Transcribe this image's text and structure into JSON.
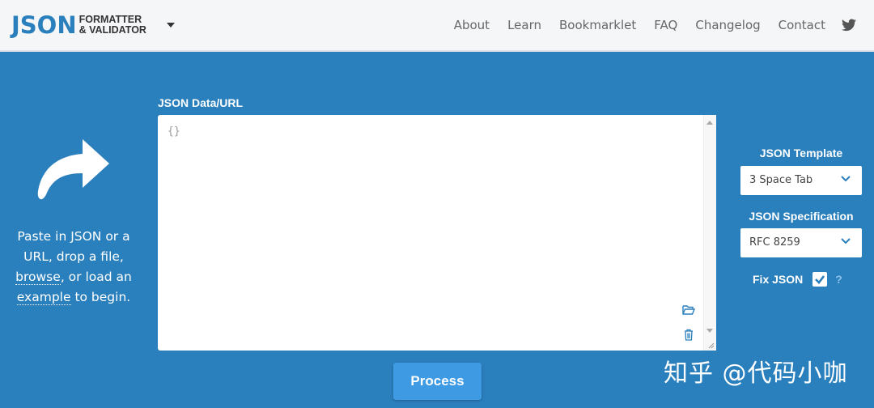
{
  "header": {
    "logo_main": "JSON",
    "logo_sub_line1": "FORMATTER",
    "logo_sub_line2": "& VALIDATOR",
    "nav": [
      "About",
      "Learn",
      "Bookmarklet",
      "FAQ",
      "Changelog",
      "Contact"
    ]
  },
  "left_panel": {
    "text_1": "Paste in JSON or a URL, drop a file, ",
    "browse_link": "browse",
    "text_2": ", or load an ",
    "example_link": "example",
    "text_3": " to begin."
  },
  "editor": {
    "label": "JSON Data/URL",
    "value": "{}"
  },
  "process_button": "Process",
  "options": {
    "template_label": "JSON Template",
    "template_value": "3 Space Tab",
    "spec_label": "JSON Specification",
    "spec_value": "RFC 8259",
    "fix_label": "Fix JSON",
    "fix_checked": true,
    "help": "?"
  },
  "watermark": "知乎 @代码小咖",
  "colors": {
    "background": "#2a7fbd",
    "topbar": "#f5f6f8",
    "button": "#3d9ae3"
  }
}
